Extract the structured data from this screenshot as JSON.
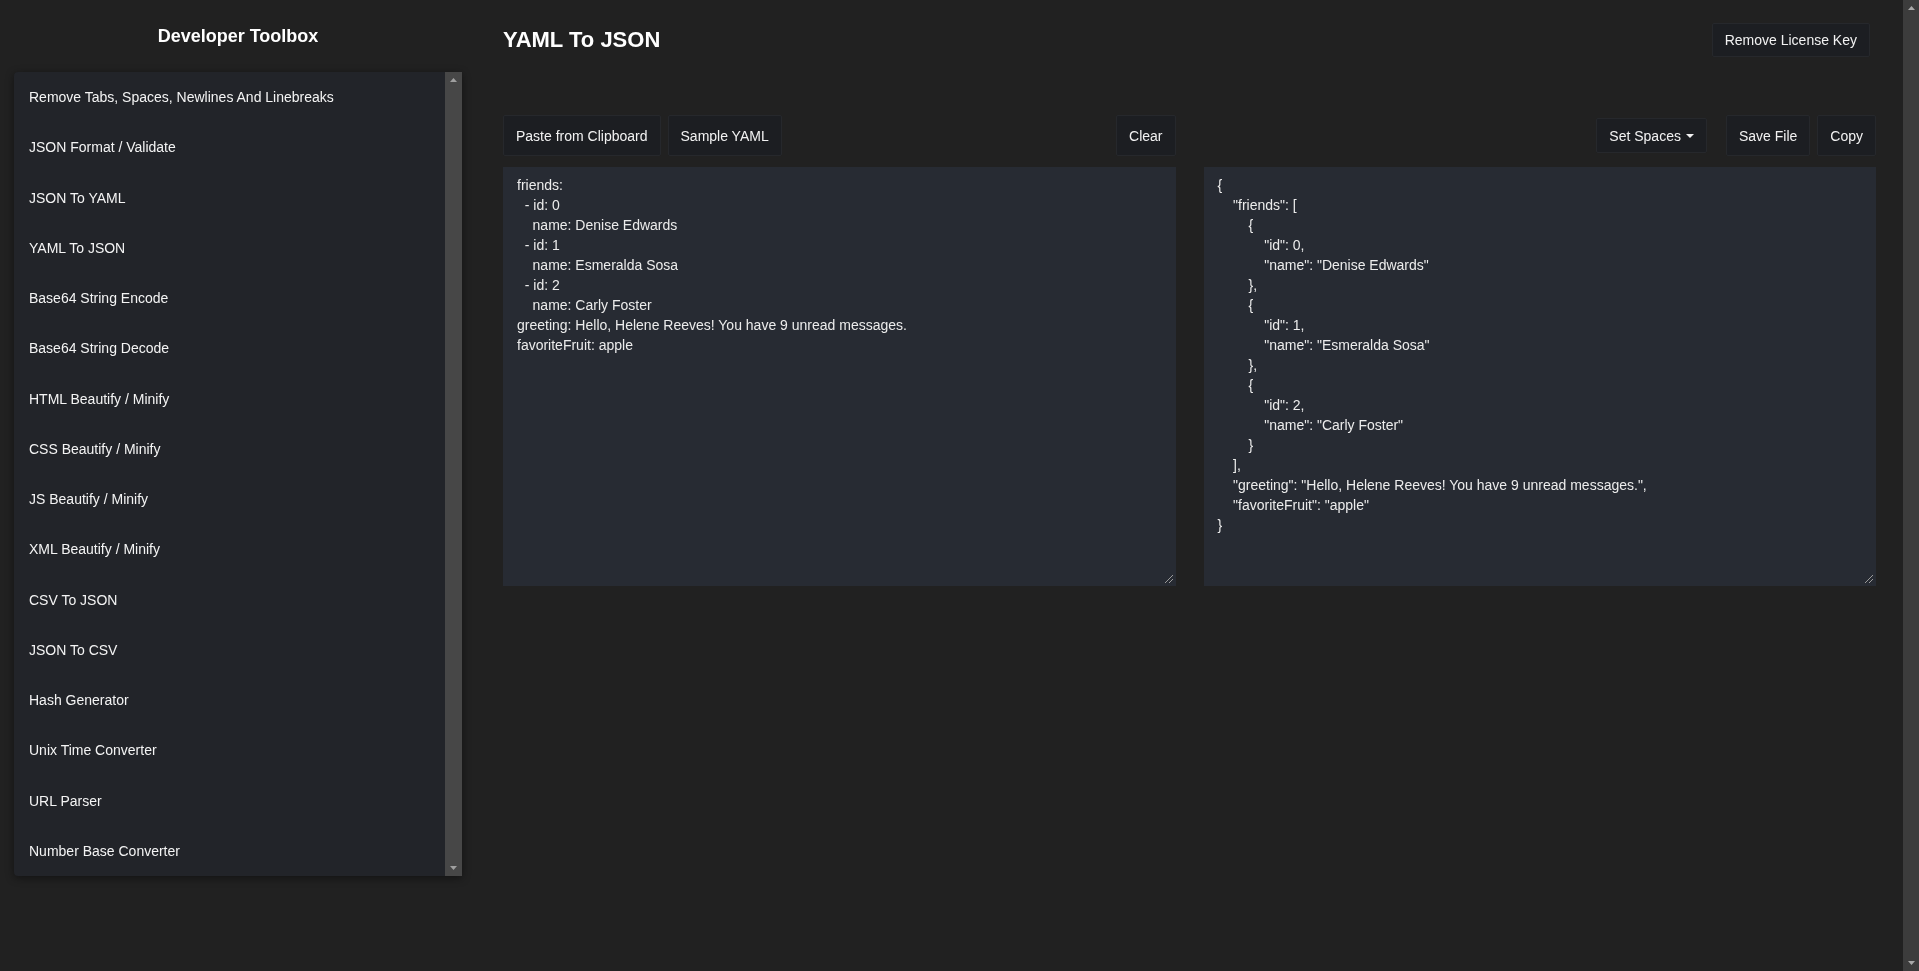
{
  "sidebar": {
    "title": "Developer Toolbox",
    "items": [
      "Remove Tabs, Spaces, Newlines And Linebreaks",
      "JSON Format / Validate",
      "JSON To YAML",
      "YAML To JSON",
      "Base64 String Encode",
      "Base64 String Decode",
      "HTML Beautify / Minify",
      "CSS Beautify / Minify",
      "JS Beautify / Minify",
      "XML Beautify / Minify",
      "CSV To JSON",
      "JSON To CSV",
      "Hash Generator",
      "Unix Time Converter",
      "URL Parser",
      "Number Base Converter"
    ]
  },
  "header": {
    "title": "YAML To JSON",
    "button": "Remove License Key"
  },
  "input_panel": {
    "buttons": [
      "Paste from Clipboard",
      "Sample YAML"
    ],
    "clear_button": "Clear",
    "value": "friends:\n  - id: 0\n    name: Denise Edwards\n  - id: 1\n    name: Esmeralda Sosa\n  - id: 2\n    name: Carly Foster\ngreeting: Hello, Helene Reeves! You have 9 unread messages.\nfavoriteFruit: apple"
  },
  "output_panel": {
    "dropdown": "Set Spaces",
    "buttons": [
      "Save File",
      "Copy"
    ],
    "value": "{\n    \"friends\": [\n        {\n            \"id\": 0,\n            \"name\": \"Denise Edwards\"\n        },\n        {\n            \"id\": 1,\n            \"name\": \"Esmeralda Sosa\"\n        },\n        {\n            \"id\": 2,\n            \"name\": \"Carly Foster\"\n        }\n    ],\n    \"greeting\": \"Hello, Helene Reeves! You have 9 unread messages.\",\n    \"favoriteFruit\": \"apple\"\n}"
  }
}
